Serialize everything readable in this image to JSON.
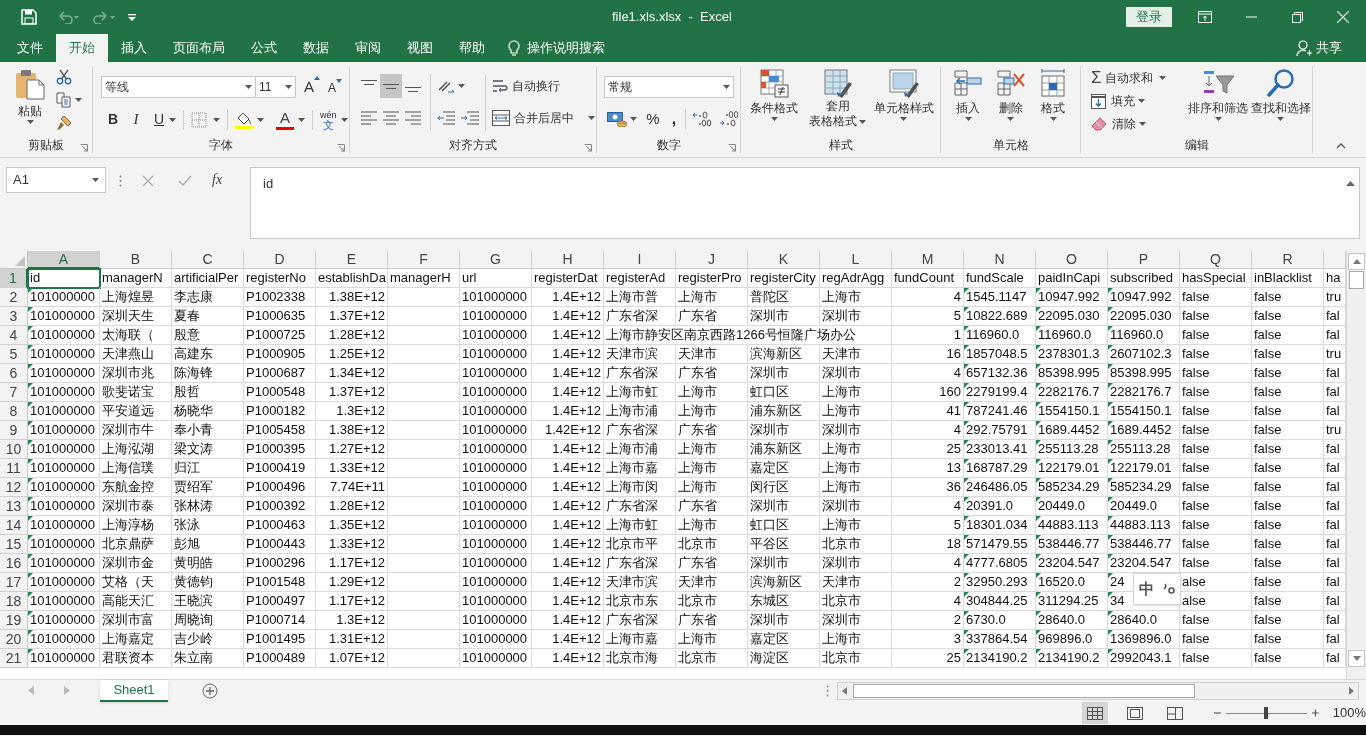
{
  "title_bar": {
    "title": "file1.xls.xlsx  -  Excel",
    "sign_in": "登录"
  },
  "ribbon_tabs": [
    {
      "label": "文件",
      "selected": false
    },
    {
      "label": "开始",
      "selected": true
    },
    {
      "label": "插入",
      "selected": false
    },
    {
      "label": "页面布局",
      "selected": false
    },
    {
      "label": "公式",
      "selected": false
    },
    {
      "label": "数据",
      "selected": false
    },
    {
      "label": "审阅",
      "selected": false
    },
    {
      "label": "视图",
      "selected": false
    },
    {
      "label": "帮助",
      "selected": false
    }
  ],
  "tell_me": "操作说明搜索",
  "share": "共享",
  "ribbon": {
    "clipboard": {
      "paste": "粘贴",
      "label": "剪贴板"
    },
    "font": {
      "name": "等线",
      "size": "11",
      "grow": "A",
      "shrink": "A",
      "bold": "B",
      "italic": "I",
      "underline": "U",
      "font_color": "A",
      "phonetic": [
        "wén",
        "文"
      ],
      "label": "字体"
    },
    "alignment": {
      "vertical": [
        {
          "selected": false
        },
        {
          "selected": true
        },
        {
          "selected": false
        }
      ],
      "wrap": "自动换行",
      "merge": "合并后居中",
      "label": "对齐方式"
    },
    "number": {
      "format": "常规",
      "percent": "%",
      "comma": ",",
      "label": "数字"
    },
    "styles": {
      "conditional": "条件格式",
      "table": [
        "套用",
        "表格格式"
      ],
      "cell_styles": "单元格样式",
      "label": "样式"
    },
    "cells": {
      "insert": "插入",
      "delete": "删除",
      "format": "格式",
      "label": "单元格"
    },
    "editing": {
      "sigma": "Σ",
      "autosum": "自动求和",
      "fill": "填充",
      "clear": "清除",
      "sort": "排序和筛选",
      "find": "查找和选择",
      "label": "编辑"
    }
  },
  "formula_bar": {
    "name_box": "A1",
    "fx": "fx",
    "value": "id"
  },
  "sheet": {
    "columns": [
      {
        "letter": "A",
        "kind": "text",
        "selected": true
      },
      {
        "letter": "B",
        "kind": "text",
        "selected": false
      },
      {
        "letter": "C",
        "kind": "text",
        "selected": false
      },
      {
        "letter": "D",
        "kind": "text",
        "selected": false
      },
      {
        "letter": "E",
        "kind": "number",
        "selected": false
      },
      {
        "letter": "F",
        "kind": "text",
        "selected": false
      },
      {
        "letter": "G",
        "kind": "text",
        "selected": false
      },
      {
        "letter": "H",
        "kind": "number",
        "selected": false
      },
      {
        "letter": "I",
        "kind": "text",
        "selected": false
      },
      {
        "letter": "J",
        "kind": "text",
        "selected": false
      },
      {
        "letter": "K",
        "kind": "text",
        "selected": false
      },
      {
        "letter": "L",
        "kind": "text",
        "selected": false
      },
      {
        "letter": "M",
        "kind": "number",
        "selected": false
      },
      {
        "letter": "N",
        "kind": "text",
        "selected": false
      },
      {
        "letter": "O",
        "kind": "text",
        "selected": false
      },
      {
        "letter": "P",
        "kind": "text",
        "selected": false
      },
      {
        "letter": "Q",
        "kind": "text",
        "selected": false
      },
      {
        "letter": "R",
        "kind": "text",
        "selected": false
      },
      {
        "kind": "text",
        "selected": false
      }
    ],
    "rows": [
      {
        "number": "1",
        "selected": true,
        "cells": [
          "id",
          "managerN",
          "artificialPer",
          "registerNo",
          "establishDa",
          "managerH",
          "url",
          "registerDat",
          "registerAd",
          "registerPro",
          "registerCity",
          "regAdrAgg",
          "fundCount",
          "fundScale",
          "paidInCapi",
          "subscribed",
          "hasSpecial",
          "inBlacklist",
          "ha"
        ]
      },
      {
        "number": "2",
        "selected": false,
        "cells": [
          {
            "text": "101000000",
            "flagged": true
          },
          "上海煌昱",
          "李志康",
          "P1002338",
          "1.38E+12",
          "",
          "101000000",
          "1.4E+12",
          "上海市普",
          "上海市",
          "普陀区",
          "上海市",
          "4",
          {
            "text": "1545.1147",
            "flagged": true
          },
          {
            "text": "10947.992",
            "flagged": true
          },
          {
            "text": "10947.992",
            "flagged": true
          },
          "false",
          "false",
          "tru"
        ]
      },
      {
        "number": "3",
        "selected": false,
        "cells": [
          {
            "text": "101000000",
            "flagged": true
          },
          "深圳天生",
          "夏春",
          "P1000635",
          "1.37E+12",
          "",
          "101000000",
          "1.4E+12",
          "广东省深",
          "广东省",
          "深圳市",
          "深圳市",
          "5",
          {
            "text": "10822.689",
            "flagged": true
          },
          {
            "text": "22095.030",
            "flagged": true
          },
          {
            "text": "22095.030",
            "flagged": true
          },
          "false",
          "false",
          "fal"
        ]
      },
      {
        "number": "4",
        "selected": false,
        "cells": [
          {
            "text": "101000000",
            "flagged": true
          },
          "太海联（",
          "殷意",
          "P1000725",
          "1.28E+12",
          "",
          "101000000",
          "1.4E+12",
          "上海市静安区南京西路1266号恒隆广场办公",
          "",
          "",
          "",
          "1",
          {
            "text": "116960.0",
            "flagged": true
          },
          {
            "text": "116960.0",
            "flagged": true
          },
          {
            "text": "116960.0",
            "flagged": true
          },
          "false",
          "false",
          "fal"
        ]
      },
      {
        "number": "5",
        "selected": false,
        "cells": [
          {
            "text": "101000000",
            "flagged": true
          },
          "天津燕山",
          "高建东",
          "P1000905",
          "1.25E+12",
          "",
          "101000000",
          "1.4E+12",
          "天津市滨",
          "天津市",
          "滨海新区",
          "天津市",
          "16",
          {
            "text": "1857048.5",
            "flagged": true
          },
          {
            "text": "2378301.3",
            "flagged": true
          },
          {
            "text": "2607102.3",
            "flagged": true
          },
          "false",
          "false",
          "tru"
        ]
      },
      {
        "number": "6",
        "selected": false,
        "cells": [
          {
            "text": "101000000",
            "flagged": true
          },
          "深圳市兆",
          "陈海锋",
          "P1000687",
          "1.34E+12",
          "",
          "101000000",
          "1.4E+12",
          "广东省深",
          "广东省",
          "深圳市",
          "深圳市",
          "4",
          {
            "text": "657132.36",
            "flagged": true
          },
          {
            "text": "85398.995",
            "flagged": true
          },
          {
            "text": "85398.995",
            "flagged": true
          },
          "false",
          "false",
          "fal"
        ]
      },
      {
        "number": "7",
        "selected": false,
        "cells": [
          {
            "text": "101000000",
            "flagged": true
          },
          "歌斐诺宝",
          "殷哲",
          "P1000548",
          "1.37E+12",
          "",
          "101000000",
          "1.4E+12",
          "上海市虹",
          "上海市",
          "虹口区",
          "上海市",
          "160",
          {
            "text": "2279199.4",
            "flagged": true
          },
          {
            "text": "2282176.7",
            "flagged": true
          },
          {
            "text": "2282176.7",
            "flagged": true
          },
          "false",
          "false",
          "fal"
        ]
      },
      {
        "number": "8",
        "selected": false,
        "cells": [
          {
            "text": "101000000",
            "flagged": true
          },
          "平安道远",
          "杨晓华",
          "P1000182",
          "1.3E+12",
          "",
          "101000000",
          "1.4E+12",
          "上海市浦",
          "上海市",
          "浦东新区",
          "上海市",
          "41",
          {
            "text": "787241.46",
            "flagged": true
          },
          {
            "text": "1554150.1",
            "flagged": true
          },
          {
            "text": "1554150.1",
            "flagged": true
          },
          "false",
          "false",
          "fal"
        ]
      },
      {
        "number": "9",
        "selected": false,
        "cells": [
          {
            "text": "101000000",
            "flagged": true
          },
          "深圳市牛",
          "奉小青",
          "P1005458",
          "1.38E+12",
          "",
          "101000000",
          "1.42E+12",
          "广东省深",
          "广东省",
          "深圳市",
          "深圳市",
          "4",
          {
            "text": "292.75791",
            "flagged": true
          },
          {
            "text": "1689.4452",
            "flagged": true
          },
          {
            "text": "1689.4452",
            "flagged": true
          },
          "false",
          "false",
          "tru"
        ]
      },
      {
        "number": "10",
        "selected": false,
        "cells": [
          {
            "text": "101000000",
            "flagged": true
          },
          "上海泓湖",
          "梁文涛",
          "P1000395",
          "1.27E+12",
          "",
          "101000000",
          "1.4E+12",
          "上海市浦",
          "上海市",
          "浦东新区",
          "上海市",
          "25",
          {
            "text": "233013.41",
            "flagged": true
          },
          {
            "text": "255113.28",
            "flagged": true
          },
          {
            "text": "255113.28",
            "flagged": true
          },
          "false",
          "false",
          "fal"
        ]
      },
      {
        "number": "11",
        "selected": false,
        "cells": [
          {
            "text": "101000000",
            "flagged": true
          },
          "上海信璞",
          "归江",
          "P1000419",
          "1.33E+12",
          "",
          "101000000",
          "1.4E+12",
          "上海市嘉",
          "上海市",
          "嘉定区",
          "上海市",
          "13",
          {
            "text": "168787.29",
            "flagged": true
          },
          {
            "text": "122179.01",
            "flagged": true
          },
          {
            "text": "122179.01",
            "flagged": true
          },
          "false",
          "false",
          "fal"
        ]
      },
      {
        "number": "12",
        "selected": false,
        "cells": [
          {
            "text": "101000000",
            "flagged": true
          },
          "东航金控",
          "贾绍军",
          "P1000496",
          "7.74E+11",
          "",
          "101000000",
          "1.4E+12",
          "上海市闵",
          "上海市",
          "闵行区",
          "上海市",
          "36",
          {
            "text": "246486.05",
            "flagged": true
          },
          {
            "text": "585234.29",
            "flagged": true
          },
          {
            "text": "585234.29",
            "flagged": true
          },
          "false",
          "false",
          "fal"
        ]
      },
      {
        "number": "13",
        "selected": false,
        "cells": [
          {
            "text": "101000000",
            "flagged": true
          },
          "深圳市泰",
          "张林涛",
          "P1000392",
          "1.28E+12",
          "",
          "101000000",
          "1.4E+12",
          "广东省深",
          "广东省",
          "深圳市",
          "深圳市",
          "4",
          {
            "text": "20391.0",
            "flagged": true
          },
          {
            "text": "20449.0",
            "flagged": true
          },
          {
            "text": "20449.0",
            "flagged": true
          },
          "false",
          "false",
          "fal"
        ]
      },
      {
        "number": "14",
        "selected": false,
        "cells": [
          {
            "text": "101000000",
            "flagged": true
          },
          "上海淳杨",
          "张泳",
          "P1000463",
          "1.35E+12",
          "",
          "101000000",
          "1.4E+12",
          "上海市虹",
          "上海市",
          "虹口区",
          "上海市",
          "5",
          {
            "text": "18301.034",
            "flagged": true
          },
          {
            "text": "44883.113",
            "flagged": true
          },
          {
            "text": "44883.113",
            "flagged": true
          },
          "false",
          "false",
          "fal"
        ]
      },
      {
        "number": "15",
        "selected": false,
        "cells": [
          {
            "text": "101000000",
            "flagged": true
          },
          "北京鼎萨",
          "彭旭",
          "P1000443",
          "1.33E+12",
          "",
          "101000000",
          "1.4E+12",
          "北京市平",
          "北京市",
          "平谷区",
          "北京市",
          "18",
          {
            "text": "571479.55",
            "flagged": true
          },
          {
            "text": "538446.77",
            "flagged": true
          },
          {
            "text": "538446.77",
            "flagged": true
          },
          "false",
          "false",
          "fal"
        ]
      },
      {
        "number": "16",
        "selected": false,
        "cells": [
          {
            "text": "101000000",
            "flagged": true
          },
          "深圳市金",
          "黄明皓",
          "P1000296",
          "1.17E+12",
          "",
          "101000000",
          "1.4E+12",
          "广东省深",
          "广东省",
          "深圳市",
          "深圳市",
          "4",
          {
            "text": "4777.6805",
            "flagged": true
          },
          {
            "text": "23204.547",
            "flagged": true
          },
          {
            "text": "23204.547",
            "flagged": true
          },
          "false",
          "false",
          "fal"
        ]
      },
      {
        "number": "17",
        "selected": false,
        "cells": [
          {
            "text": "101000000",
            "flagged": true
          },
          "艾格（天",
          "黄德钧",
          "P1001548",
          "1.29E+12",
          "",
          "101000000",
          "1.4E+12",
          "天津市滨",
          "天津市",
          "滨海新区",
          "天津市",
          "2",
          {
            "text": "32950.293",
            "flagged": true
          },
          {
            "text": "16520.0",
            "flagged": true
          },
          {
            "text": "24",
            "flagged": true
          },
          "alse",
          "false",
          "fal"
        ]
      },
      {
        "number": "18",
        "selected": false,
        "cells": [
          {
            "text": "101000000",
            "flagged": true
          },
          "高能天汇",
          "王晓滨",
          "P1000497",
          "1.17E+12",
          "",
          "101000000",
          "1.4E+12",
          "北京市东",
          "北京市",
          "东城区",
          "北京市",
          "4",
          {
            "text": "304844.25",
            "flagged": true
          },
          {
            "text": "311294.25",
            "flagged": true
          },
          {
            "text": "34",
            "flagged": true
          },
          "alse",
          "false",
          "fal"
        ]
      },
      {
        "number": "19",
        "selected": false,
        "cells": [
          {
            "text": "101000000",
            "flagged": true
          },
          "深圳市富",
          "周晓询",
          "P1000714",
          "1.3E+12",
          "",
          "101000000",
          "1.4E+12",
          "广东省深",
          "广东省",
          "深圳市",
          "深圳市",
          "2",
          {
            "text": "6730.0",
            "flagged": true
          },
          {
            "text": "28640.0",
            "flagged": true
          },
          {
            "text": "28640.0",
            "flagged": true
          },
          "false",
          "false",
          "fal"
        ]
      },
      {
        "number": "20",
        "selected": false,
        "cells": [
          {
            "text": "101000000",
            "flagged": true
          },
          "上海嘉定",
          "吉少岭",
          "P1001495",
          "1.31E+12",
          "",
          "101000000",
          "1.4E+12",
          "上海市嘉",
          "上海市",
          "嘉定区",
          "上海市",
          "3",
          {
            "text": "337864.54",
            "flagged": true
          },
          {
            "text": "969896.0",
            "flagged": true
          },
          {
            "text": "1369896.0",
            "flagged": true
          },
          "false",
          "false",
          "fal"
        ]
      },
      {
        "number": "21",
        "selected": false,
        "cells": [
          {
            "text": "101000000",
            "flagged": true
          },
          "君联资本",
          "朱立南",
          "P1000489",
          "1.07E+12",
          "",
          "101000000",
          "1.4E+12",
          "北京市海",
          "北京市",
          "海淀区",
          "北京市",
          "25",
          {
            "text": "2134190.2",
            "flagged": true
          },
          {
            "text": "2134190.2",
            "flagged": true
          },
          {
            "text": "2992043.1",
            "flagged": true
          },
          "false",
          "false",
          "fal"
        ]
      }
    ]
  },
  "ime": {
    "mode": "中"
  },
  "sheet_tabs": [
    {
      "name": "Sheet1",
      "selected": true
    }
  ],
  "status_bar": {
    "views": [
      {
        "selected": true
      },
      {
        "selected": false
      },
      {
        "selected": false
      }
    ],
    "zoom": {
      "level": 0.5,
      "reading": "100%"
    }
  }
}
